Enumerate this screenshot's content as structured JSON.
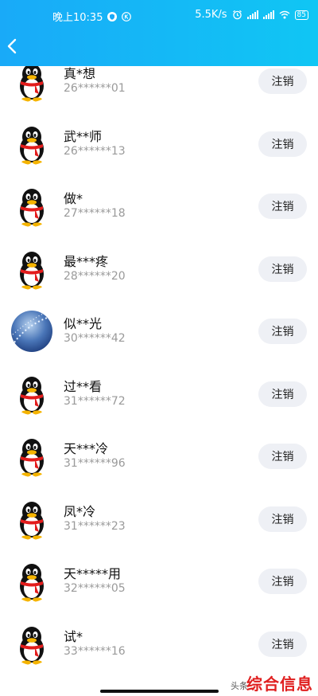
{
  "status_bar": {
    "time": "晚上10:35",
    "network_speed": "5.5K/s",
    "battery": "85",
    "icons": [
      "shield-notification-icon",
      "k-notification-icon",
      "alarm-icon",
      "signal-icon",
      "signal-icon",
      "wifi-icon",
      "battery-icon"
    ]
  },
  "header": {
    "back_icon": "back-arrow-icon",
    "accent": "#19aaf8"
  },
  "accounts": [
    {
      "name": "真*想",
      "id": "26******01",
      "avatar": "qq-penguin",
      "action": "注销"
    },
    {
      "name": "武**师",
      "id": "26******13",
      "avatar": "qq-penguin",
      "action": "注销"
    },
    {
      "name": "做*",
      "id": "27******18",
      "avatar": "qq-penguin",
      "action": "注销"
    },
    {
      "name": "最***疼",
      "id": "28******20",
      "avatar": "qq-penguin",
      "action": "注销"
    },
    {
      "name": "似**光",
      "id": "30******42",
      "avatar": "photo",
      "action": "注销"
    },
    {
      "name": "过**看",
      "id": "31******72",
      "avatar": "qq-penguin",
      "action": "注销"
    },
    {
      "name": "天***冷",
      "id": "31******96",
      "avatar": "qq-penguin",
      "action": "注销"
    },
    {
      "name": "凤*冷",
      "id": "31******23",
      "avatar": "qq-penguin",
      "action": "注销"
    },
    {
      "name": "天*****用",
      "id": "32******05",
      "avatar": "qq-penguin",
      "action": "注销"
    },
    {
      "name": "试*",
      "id": "33******16",
      "avatar": "qq-penguin",
      "action": "注销"
    }
  ],
  "watermark": {
    "source": "头条",
    "brand": "综合信息"
  }
}
